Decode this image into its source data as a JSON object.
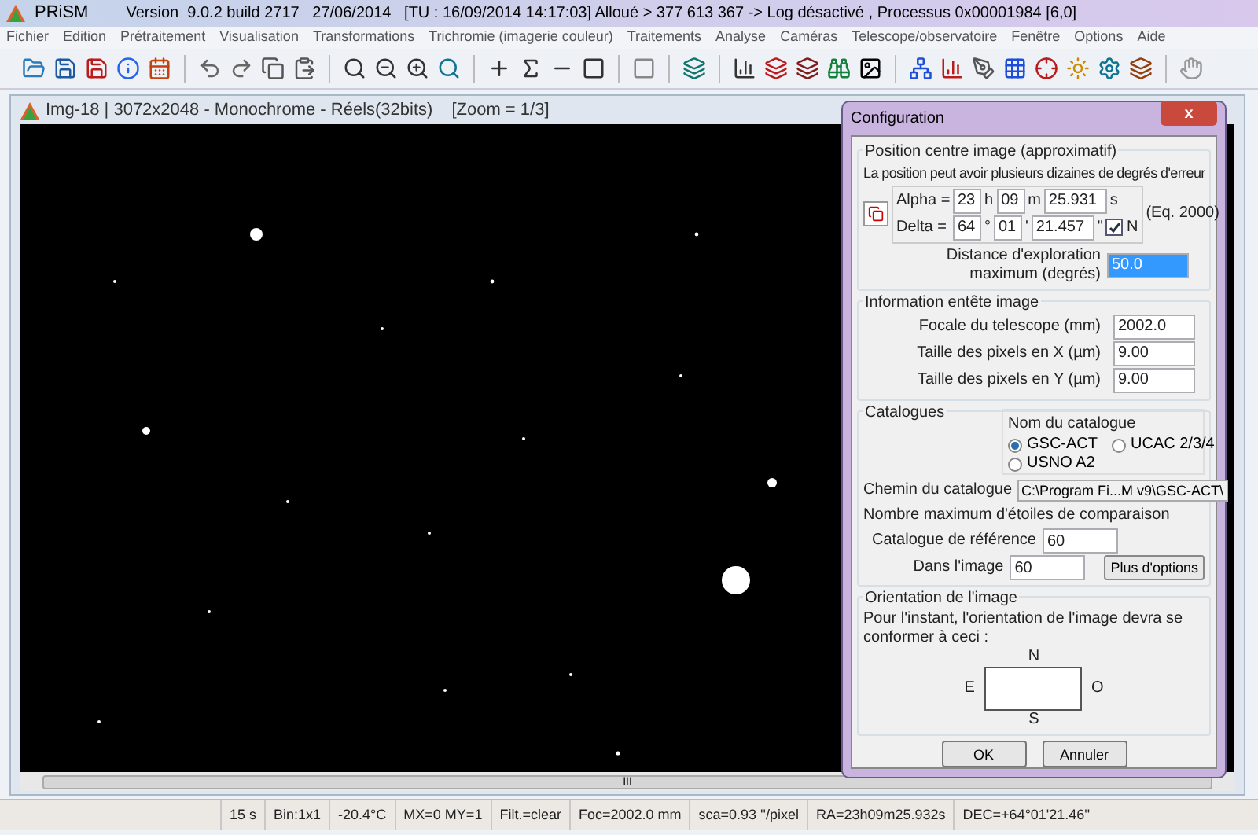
{
  "title_bar": {
    "app": "PRiSM",
    "text": "Version  9.0.2 build 2717   27/06/2014   [TU : 16/09/2014 14:17:03] Alloué > 377 613 367 -> Log désactivé , Processus 0x00001984 [6,0]"
  },
  "menu": [
    "Fichier",
    "Edition",
    "Prétraitement",
    "Visualisation",
    "Transformations",
    "Trichromie (imagerie couleur)",
    "Traitements",
    "Analyse",
    "Caméras",
    "Telescope/observatoire",
    "Fenêtre",
    "Options",
    "Aide"
  ],
  "image_window": {
    "title": "Img-18 | 3072x2048 - Monochrome - Réels(32bits)",
    "zoom": "[Zoom = 1/3]",
    "scroll_grip": "III"
  },
  "dialog": {
    "title": "Configuration",
    "close": "x",
    "position": {
      "legend": "Position centre image (approximatif)",
      "note": "La position peut avoir plusieurs dizaines de degrés d'erreur",
      "alpha": {
        "label": "Alpha =",
        "h": "23",
        "h_unit": "h",
        "m": "09",
        "m_unit": "m",
        "s": "25.931",
        "s_unit": "s"
      },
      "delta": {
        "label": "Delta =",
        "d": "64",
        "d_unit": "°",
        "m": "01",
        "m_unit": "'",
        "s": "21.457",
        "s_unit": "\""
      },
      "north": {
        "label": "N",
        "checked": true
      },
      "epoch": "(Eq. 2000)",
      "distance": {
        "label_1": "Distance d'exploration",
        "label_2": "maximum (degrés)",
        "value": "50.0",
        "selected": true
      }
    },
    "header": {
      "legend": "Information entête image",
      "rows": [
        {
          "label": "Focale du telescope (mm)",
          "value": "2002.0"
        },
        {
          "label": "Taille des pixels en X (µm)",
          "value": "9.00"
        },
        {
          "label": "Taille des pixels en Y (µm)",
          "value": "9.00"
        }
      ]
    },
    "catalogues": {
      "legend": "Catalogues",
      "group": "Nom du catalogue",
      "options": [
        {
          "label": "GSC-ACT",
          "selected": true
        },
        {
          "label": "UCAC 2/3/4",
          "selected": false
        },
        {
          "label": "USNO A2",
          "selected": false
        }
      ],
      "path_label": "Chemin du catalogue",
      "path": "C:\\Program Fi...M v9\\GSC-ACT\\",
      "max_label": "Nombre maximum d'étoiles de comparaison",
      "ref": {
        "label": "Catalogue de référence",
        "value": "60"
      },
      "image": {
        "label": "Dans l'image",
        "value": "60"
      },
      "more": "Plus d'options"
    },
    "orientation": {
      "legend": "Orientation de l'image",
      "note": "Pour l'instant, l'orientation de l'image devra se conformer à ceci :",
      "n": "N",
      "e": "E",
      "o": "O",
      "s": "S"
    },
    "buttons": [
      "OK",
      "Annuler"
    ]
  },
  "status_bar": [
    "15 s",
    "Bin:1x1",
    "-20.4°C",
    "MX=0 MY=1",
    "Filt.=clear",
    "Foc=2002.0 mm",
    "sca=0.93 ''/pixel",
    "RA=23h09m25.932s",
    "DEC=+64°01'21.46''"
  ]
}
